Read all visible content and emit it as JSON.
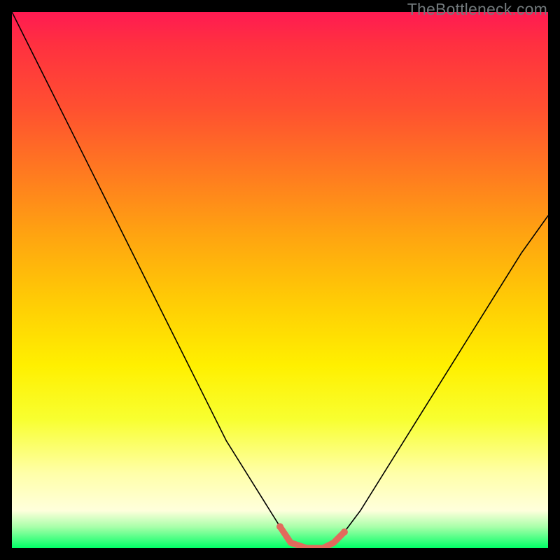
{
  "watermark": "TheBottleneck.com",
  "chart_data": {
    "type": "line",
    "title": "",
    "xlabel": "",
    "ylabel": "",
    "xlim": [
      0,
      100
    ],
    "ylim": [
      0,
      100
    ],
    "series": [
      {
        "name": "bottleneck-curve",
        "x": [
          0,
          5,
          10,
          15,
          20,
          25,
          30,
          35,
          40,
          45,
          50,
          52,
          55,
          58,
          60,
          62,
          65,
          70,
          75,
          80,
          85,
          90,
          95,
          100
        ],
        "values": [
          100,
          90,
          80,
          70,
          60,
          50,
          40,
          30,
          20,
          12,
          4,
          1,
          0,
          0,
          1,
          3,
          7,
          15,
          23,
          31,
          39,
          47,
          55,
          62
        ]
      },
      {
        "name": "highlight-segment",
        "x": [
          50,
          52,
          55,
          58,
          60,
          62
        ],
        "values": [
          4,
          1,
          0,
          0,
          1,
          3
        ]
      }
    ],
    "colors": {
      "curve": "#000000",
      "highlight": "#e26a5c",
      "gradient_top": "#ff1a52",
      "gradient_bottom": "#00ff66"
    }
  }
}
